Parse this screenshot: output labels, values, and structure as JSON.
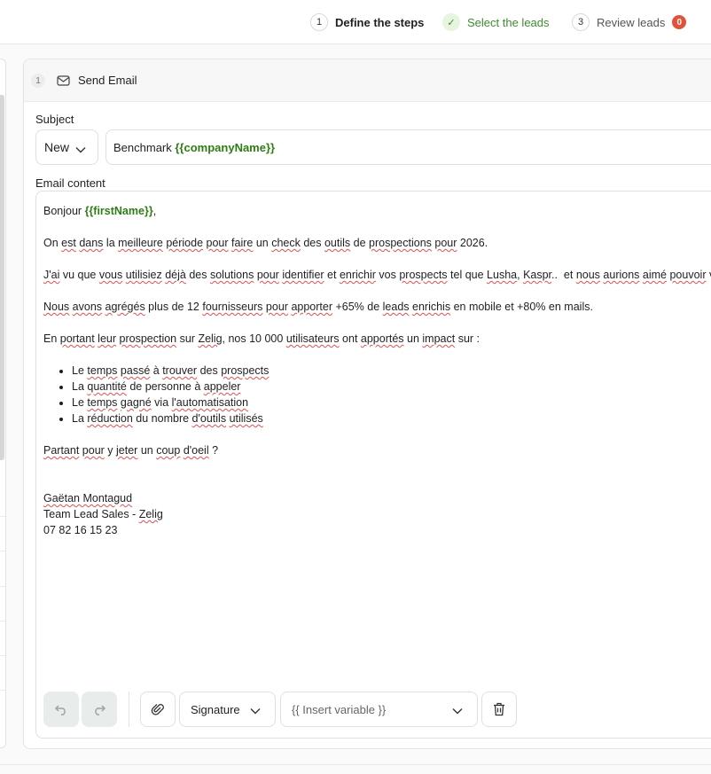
{
  "stepper": {
    "steps": [
      {
        "number": "1",
        "label": "Define the steps"
      },
      {
        "number": "✓",
        "label": "Select the leads"
      },
      {
        "number": "3",
        "label": "Review leads",
        "badge": "0"
      }
    ]
  },
  "card": {
    "index": "1",
    "title": "Send Email",
    "subject_label": "Subject",
    "subject_mode": "New",
    "subject_text": "Benchmark ",
    "subject_variable": "{{companyName}}",
    "content_label": "Email content"
  },
  "email": {
    "greeting": "Bonjour ",
    "greeting_variable": "{{firstName}}",
    "greeting_end": ",",
    "p1": [
      "On ",
      "est",
      " ",
      "dans",
      " la ",
      "meilleure",
      " ",
      "période",
      " ",
      "pour",
      " ",
      "faire",
      " un ",
      "check",
      " des ",
      "outils",
      " de ",
      "prospections",
      " ",
      "pour",
      " 2026."
    ],
    "p2": [
      "J'ai",
      " vu que ",
      "vous",
      " ",
      "utilisiez",
      " ",
      "déjà",
      " des ",
      "solutions",
      " ",
      "pour",
      " ",
      "identifier",
      " et ",
      "enrichir",
      " vos ",
      "prospects",
      " tel que ",
      "Lusha",
      ", ",
      "Kaspr",
      "..  et ",
      "nous",
      " ",
      "aurions",
      " ",
      "aimé",
      " ",
      "pouvoir",
      " vous"
    ],
    "p3": [
      "Nous",
      " ",
      "avons",
      " ",
      "agrégés",
      " plus de 12 ",
      "fournisseurs",
      " ",
      "pour",
      " ",
      "apporter",
      " +65% de ",
      "leads",
      " ",
      "enrichis",
      " en mobile et +80% en mails."
    ],
    "p4": [
      "En ",
      "portant",
      " ",
      "leur",
      " ",
      "prospection",
      " sur ",
      "Zelig",
      ", nos 10 000 ",
      "utilisateurs",
      " ont ",
      "apportés",
      " un ",
      "impact",
      " sur :"
    ],
    "bullets": [
      [
        "Le ",
        "temps",
        " ",
        "passé",
        " à ",
        "trouver",
        " des ",
        "prospects"
      ],
      [
        "La ",
        "quantité",
        " de ",
        "personne",
        " à ",
        "appeler"
      ],
      [
        "Le ",
        "temps",
        " ",
        "gagné",
        " via ",
        "l'automatisation"
      ],
      [
        "La ",
        "réduction",
        " du nombre ",
        "d'outils",
        " ",
        "utilisés"
      ]
    ],
    "p5": [
      "Partant",
      " ",
      "pour",
      " y ",
      "jeter",
      " un ",
      "coup",
      " ",
      "d'oeil",
      " ?"
    ],
    "sig_name": "Gaëtan Montagud",
    "sig_title": "Team Lead Sales - ",
    "sig_company": "Zelig",
    "sig_phone": "07 82 16 15 23"
  },
  "toolbar": {
    "signature_label": "Signature",
    "insert_variable_placeholder": "{{ Insert variable }}"
  },
  "colors": {
    "accent_green": "#2e7d14",
    "badge_red": "#e0523a",
    "spell_underline": "#e05050"
  }
}
